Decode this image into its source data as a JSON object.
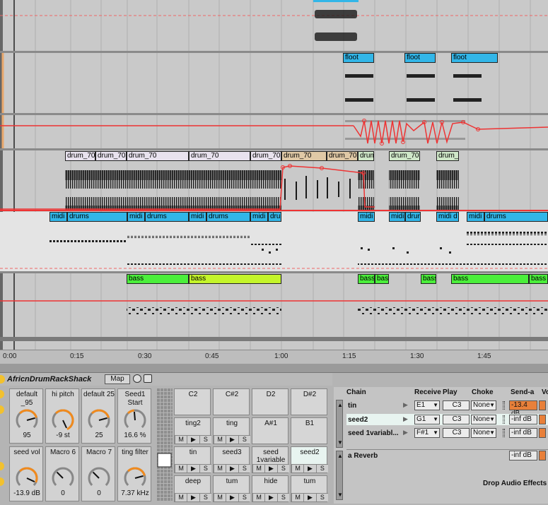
{
  "colors": {
    "accent": "#ff5a5a",
    "clip_blue": "#32b6e8",
    "clip_green": "#4bef3b",
    "clip_lime": "#c4f52a",
    "selected": "#e8f4f0"
  },
  "arrangement": {
    "floot_clips": [
      "floot",
      "floot",
      "floot"
    ],
    "drum_clips": [
      "drum_70",
      "drum_70",
      "drum_70",
      "drum_70",
      "drum_70",
      "drum_70",
      "drum_70",
      "drum_",
      "drum_70",
      "drum_"
    ],
    "midi_clips": [
      "midi",
      "drums",
      "midi",
      "drums",
      "midi",
      "drums",
      "midi",
      "drur",
      "midi",
      "midi",
      "drur",
      "midi d",
      "midi",
      "drums"
    ],
    "bass_clips": [
      "bass",
      "bass",
      "bass",
      "bass",
      "bass",
      "bass",
      "bass"
    ]
  },
  "ruler": {
    "ticks": [
      "0:00",
      "0:15",
      "0:30",
      "0:45",
      "1:00",
      "1:15",
      "1:30",
      "1:45"
    ]
  },
  "device": {
    "title": "AfricnDrumRackShack",
    "map_label": "Map",
    "macros": [
      {
        "label": "default _95",
        "value": "95",
        "icon": "knob-icon"
      },
      {
        "label": "hi pitch",
        "value": "-9 st",
        "icon": "knob-icon"
      },
      {
        "label": "default 25",
        "value": "25",
        "icon": "knob-icon"
      },
      {
        "label": "Seed1 Start",
        "value": "16.6 %",
        "icon": "knob-icon"
      },
      {
        "label": "seed vol",
        "value": "-13.9 dB",
        "icon": "knob-icon"
      },
      {
        "label": "Macro 6",
        "value": "0",
        "icon": "knob-icon"
      },
      {
        "label": "Macro 7",
        "value": "0",
        "icon": "knob-icon"
      },
      {
        "label": "ting filter",
        "value": "7.37 kHz",
        "icon": "knob-icon"
      }
    ],
    "pads": [
      {
        "name": "C2",
        "mss": false
      },
      {
        "name": "C#2",
        "mss": false
      },
      {
        "name": "D2",
        "mss": false
      },
      {
        "name": "D#2",
        "mss": false
      },
      {
        "name": "ting2",
        "mss": true
      },
      {
        "name": "ting",
        "mss": true
      },
      {
        "name": "A#1",
        "mss": false
      },
      {
        "name": "B1",
        "mss": false
      },
      {
        "name": "tin",
        "mss": true
      },
      {
        "name": "seed3",
        "mss": true
      },
      {
        "name": "seed 1variable",
        "mss": true
      },
      {
        "name": "seed2",
        "mss": true
      },
      {
        "name": "deep",
        "mss": true
      },
      {
        "name": "tum",
        "mss": true
      },
      {
        "name": "hide",
        "mss": true
      },
      {
        "name": "tum",
        "mss": true
      }
    ],
    "mss_labels": [
      "M",
      "▶",
      "S"
    ]
  },
  "chain": {
    "headers": {
      "chain": "Chain",
      "receive": "Receive",
      "play": "Play",
      "choke": "Choke",
      "send": "Send-a",
      "vol": "Vo"
    },
    "rows": [
      {
        "name": "tin",
        "receive": "E1",
        "play": "C3",
        "choke": "None",
        "send": "-13.4 dB"
      },
      {
        "name": "seed2",
        "receive": "G1",
        "play": "C3",
        "choke": "None",
        "send": "-inf dB"
      },
      {
        "name": "seed 1variabl...",
        "receive": "F#1",
        "play": "C3",
        "choke": "None",
        "send": "-inf dB"
      }
    ],
    "return": {
      "name": "a Reverb",
      "send": "-inf dB"
    },
    "drop_hint": "Drop Audio Effects I"
  }
}
